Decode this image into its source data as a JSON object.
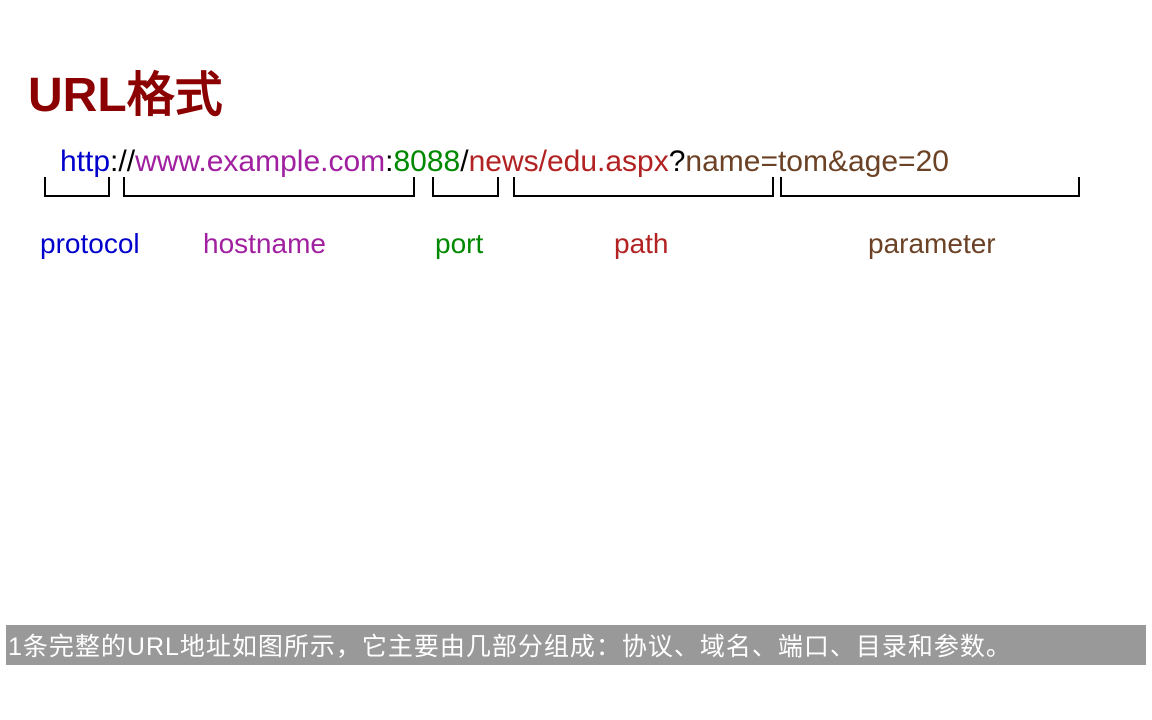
{
  "title": "URL格式",
  "url": {
    "protocol": "http",
    "sep1": "://",
    "hostname": "www.example.com",
    "sep2": ":",
    "port": "8088",
    "sep3": "/",
    "path": "news/edu.aspx",
    "sep4": "?",
    "parameter": "name=tom&age=20"
  },
  "labels": {
    "protocol": "protocol",
    "hostname": "hostname",
    "port": "port",
    "path": "path",
    "parameter": "parameter"
  },
  "colors": {
    "title": "#8B0000",
    "protocol": "#0000CC",
    "hostname": "#A020A0",
    "port": "#008800",
    "path": "#B22222",
    "parameter": "#6B4226"
  },
  "footer": "1条完整的URL地址如图所示，它主要由几部分组成：协议、域名、端口、目录和参数。"
}
